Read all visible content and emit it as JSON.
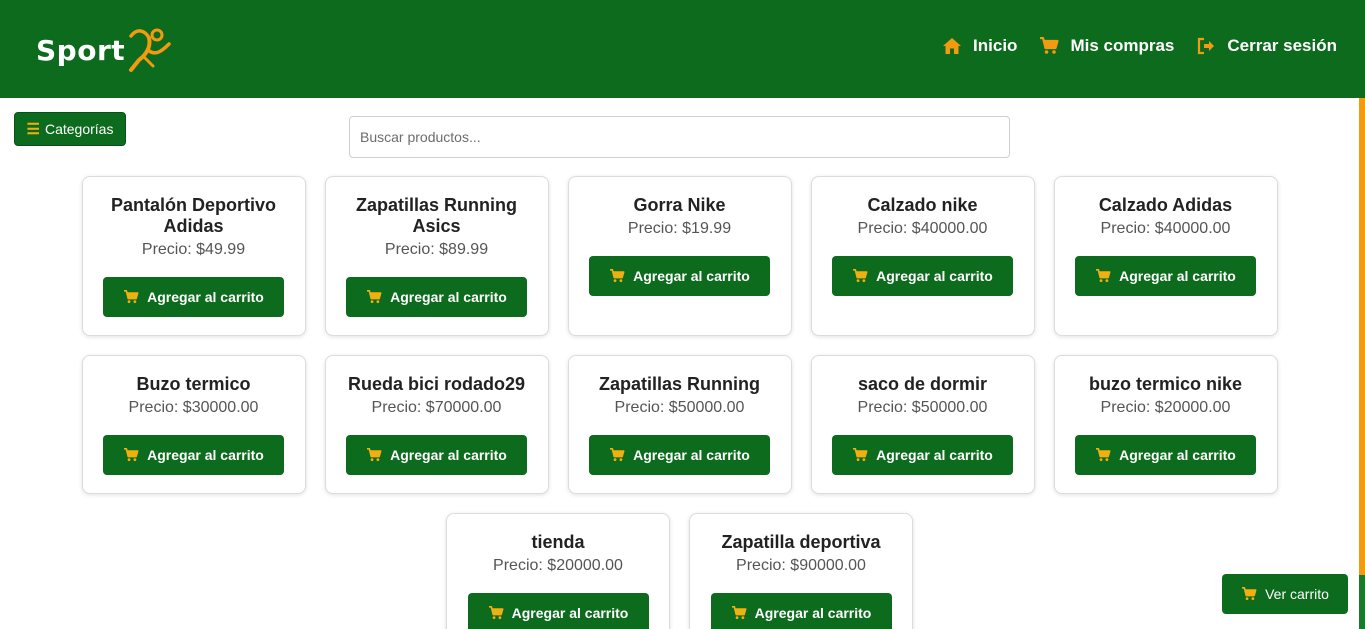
{
  "brand": {
    "name": "Sport",
    "logo_icon": "runner-icon",
    "accent": "#f29a10",
    "primary": "#0c6b1d"
  },
  "nav": [
    {
      "label": "Inicio",
      "icon": "home-icon"
    },
    {
      "label": "Mis compras",
      "icon": "cart-icon"
    },
    {
      "label": "Cerrar sesión",
      "icon": "logout-icon"
    }
  ],
  "categories_button": {
    "label": "Categorías",
    "icon": "bars-icon"
  },
  "search": {
    "placeholder": "Buscar productos...",
    "value": ""
  },
  "price_prefix": "Precio: ",
  "add_to_cart_label": "Agregar al carrito",
  "products": [
    {
      "name": "Pantalón Deportivo Adidas",
      "price": "$49.99"
    },
    {
      "name": "Zapatillas Running Asics",
      "price": "$89.99"
    },
    {
      "name": "Gorra Nike",
      "price": "$19.99"
    },
    {
      "name": "Calzado nike",
      "price": "$40000.00"
    },
    {
      "name": "Calzado Adidas",
      "price": "$40000.00"
    },
    {
      "name": "Buzo termico",
      "price": "$30000.00"
    },
    {
      "name": "Rueda bici rodado29",
      "price": "$70000.00"
    },
    {
      "name": "Zapatillas Running",
      "price": "$50000.00"
    },
    {
      "name": "saco de dormir",
      "price": "$50000.00"
    },
    {
      "name": "buzo termico nike",
      "price": "$20000.00"
    },
    {
      "name": "tienda",
      "price": "$20000.00"
    },
    {
      "name": "Zapatilla deportiva",
      "price": "$90000.00"
    }
  ],
  "view_cart": {
    "label": "Ver carrito",
    "icon": "cart-icon"
  }
}
